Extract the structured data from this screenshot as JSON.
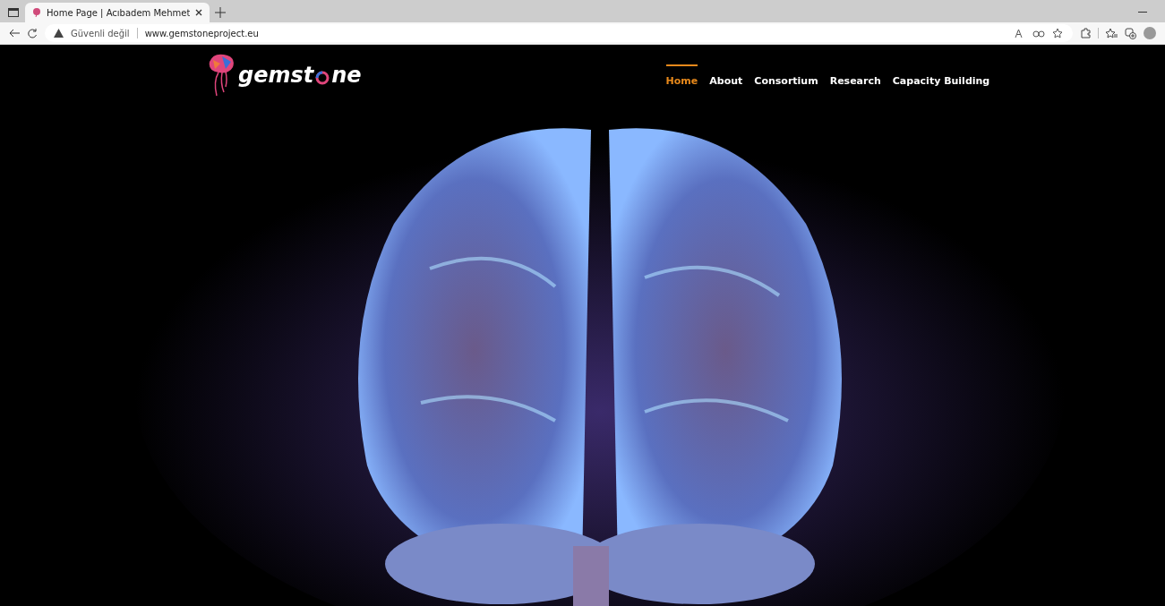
{
  "browser": {
    "tabs": [
      {
        "title": "Home Page | Acıbadem Mehmet",
        "selected": true
      }
    ],
    "address_bar": {
      "security": "Güvenli değil",
      "url": "www.gemstoneproject.eu"
    }
  },
  "page": {
    "logo": {
      "before": "gemst",
      "after": "ne"
    },
    "nav": [
      {
        "label": "Home",
        "selected": true
      },
      {
        "label": "About",
        "selected": false
      },
      {
        "label": "Consortium",
        "selected": false
      },
      {
        "label": "Research",
        "selected": false
      },
      {
        "label": "Capacity Building",
        "selected": false
      }
    ]
  }
}
